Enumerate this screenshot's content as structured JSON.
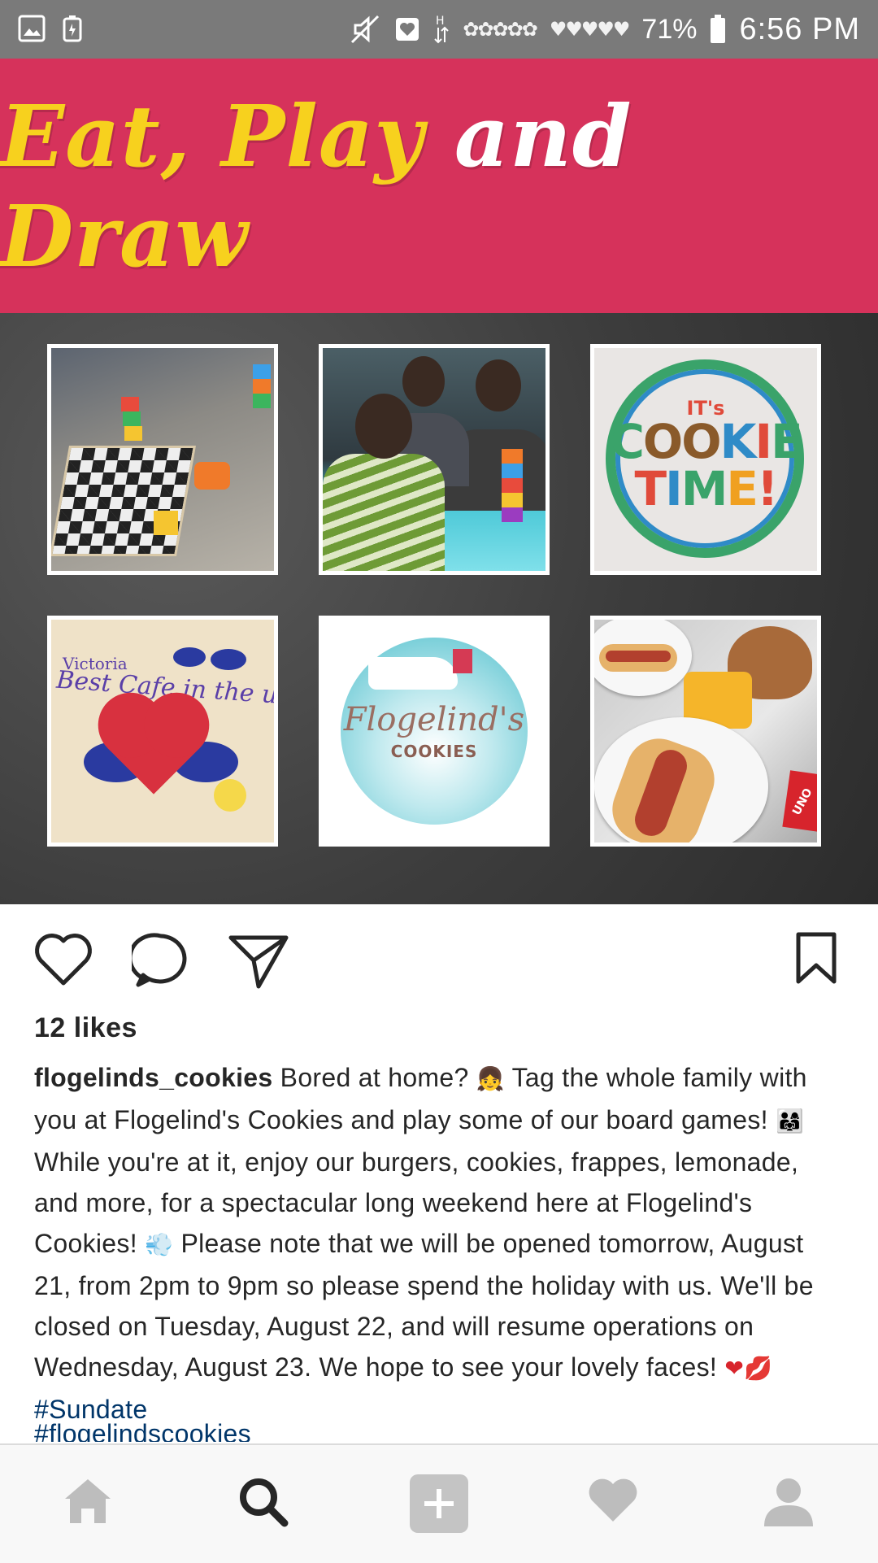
{
  "status_bar": {
    "battery": "71%",
    "time": "6:56 PM"
  },
  "post_image": {
    "title_part1": "Eat, Play",
    "title_part2": "and",
    "title_part3": "Draw",
    "tiles": {
      "cookie_its": "IT's",
      "cookie_word": "COOKIE",
      "cookie_time": "TIME!",
      "drawing_text": "Best Cafe in the universe",
      "drawing_name": "Victoria",
      "logo_name": "Flogelind's",
      "logo_sub": "COOKIES",
      "uno_label": "UNO"
    }
  },
  "actions": {
    "like": "like",
    "comment": "comment",
    "share": "share",
    "save": "save"
  },
  "likes_text": "12 likes",
  "caption": {
    "username": "flogelinds_cookies",
    "part1": " Bored at home? ",
    "emoji1": "👧",
    "part2": " Tag the whole family with you at Flogelind's Cookies and play some of our board games! ",
    "emoji2": "👨‍👩‍👧",
    "part3": "While you're at it, enjoy our burgers, cookies, frappes, lemonade, and more, for a spectacular long weekend here at Flogelind's Cookies! ",
    "emoji3": "💨",
    "part4": " Please note that we will be opened tomorrow, August 21, from 2pm to 9pm so please spend the holiday with us. We'll be closed on Tuesday, August 22, and will resume operations on Wednesday, August 23. We hope to see your lovely faces! ",
    "emoji4": "❤💋",
    "hashtag1": " #Sundate",
    "hashtag2": "#flogelindscookies"
  },
  "colors": {
    "banner": "#d6325b",
    "title_yellow": "#f7d11e",
    "hashtag": "#003569",
    "text": "#262626"
  },
  "nav": [
    "home-icon",
    "search-icon",
    "add-icon",
    "heart-icon",
    "profile-icon"
  ]
}
